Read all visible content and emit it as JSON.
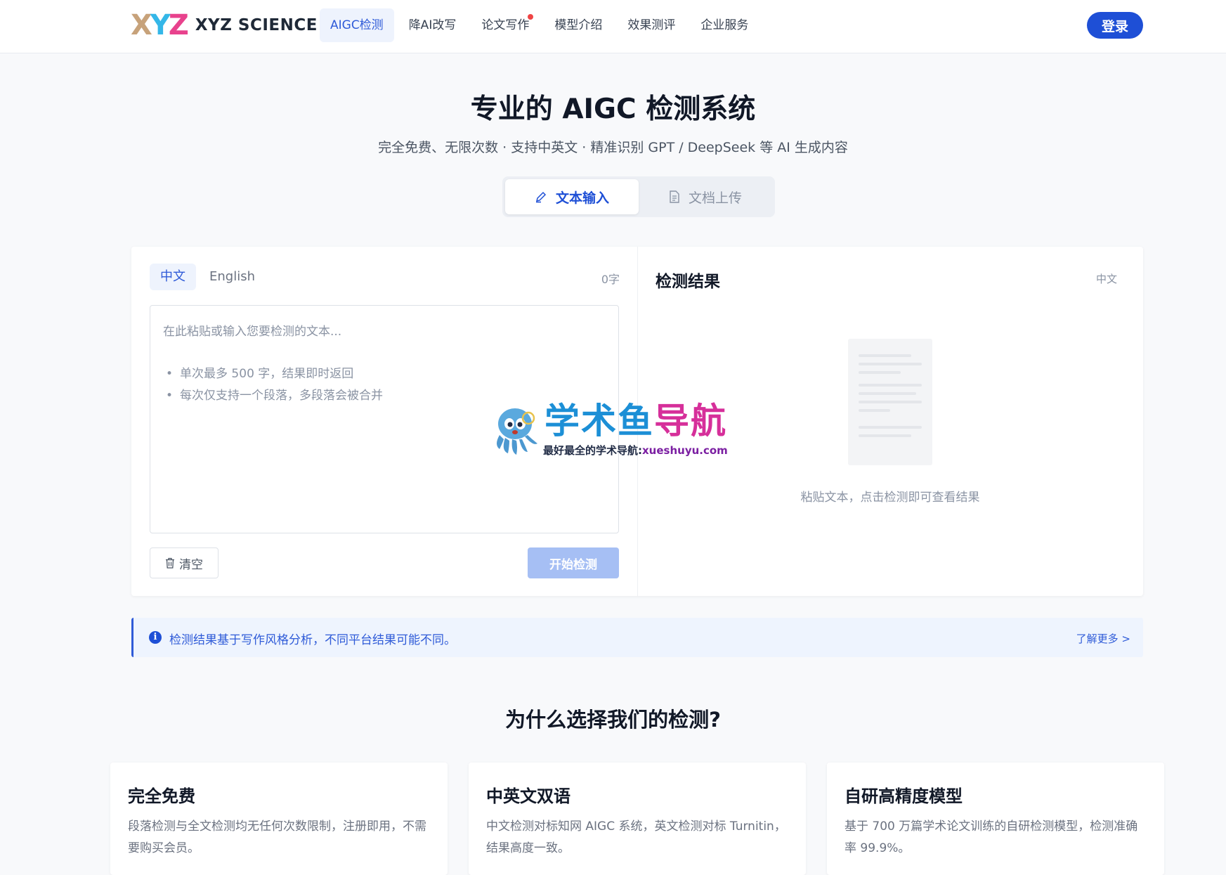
{
  "header": {
    "logo_mark": [
      "X",
      "Y",
      "Z"
    ],
    "logo_text": "XYZ SCIENCE",
    "nav": [
      {
        "label": "AIGC检测",
        "active": true
      },
      {
        "label": "降AI改写",
        "active": false
      },
      {
        "label": "论文写作",
        "active": false,
        "badge": "red-dot"
      },
      {
        "label": "模型介绍",
        "active": false
      },
      {
        "label": "效果测评",
        "active": false
      },
      {
        "label": "企业服务",
        "active": false
      }
    ],
    "login_label": "登录"
  },
  "hero": {
    "title": "专业的 AIGC 检测系统",
    "subtitle": "完全免费、无限次数 · 支持中英文 · 精准识别 GPT / DeepSeek 等 AI 生成内容"
  },
  "mode_tabs": [
    {
      "label": "文本输入",
      "icon": "pencil-icon",
      "active": true
    },
    {
      "label": "文档上传",
      "icon": "document-icon",
      "active": false
    }
  ],
  "input_panel": {
    "lang_tabs": [
      {
        "label": "中文",
        "active": true
      },
      {
        "label": "English",
        "active": false
      }
    ],
    "char_count": "0字",
    "placeholder": "在此粘贴或输入您要检测的文本...",
    "hints": [
      "单次最多 500 字，结果即时返回",
      "每次仅支持一个段落，多段落会被合并"
    ],
    "clear_label": "清空",
    "start_label": "开始检测"
  },
  "result_panel": {
    "title": "检测结果",
    "lang": "中文",
    "empty_text": "粘贴文本，点击检测即可查看结果"
  },
  "watermark": {
    "title_part1": "学术鱼",
    "title_part2": "导航",
    "subtitle": "最好最全的学术导航:",
    "url": "xueshuyu.com"
  },
  "info_bar": {
    "text": "检测结果基于写作风格分析，不同平台结果可能不同。",
    "more_label": "了解更多 >"
  },
  "why": {
    "title": "为什么选择我们的检测?",
    "features": [
      {
        "title": "完全免费",
        "desc": "段落检测与全文检测均无任何次数限制，注册即用，不需要购买会员。"
      },
      {
        "title": "中英文双语",
        "desc": "中文检测对标知网 AIGC 系统，英文检测对标 Turnitin，结果高度一致。"
      },
      {
        "title": "自研高精度模型",
        "desc": "基于 700 万篇学术论文训练的自研检测模型，检测准确率 99.9%。"
      }
    ]
  },
  "colors": {
    "primary": "#1e4fd6",
    "primary_light": "#eef3fd",
    "disabled_button": "#a6bff4",
    "notify_dot": "#ef4444",
    "page_bg": "#f8f9fb"
  }
}
